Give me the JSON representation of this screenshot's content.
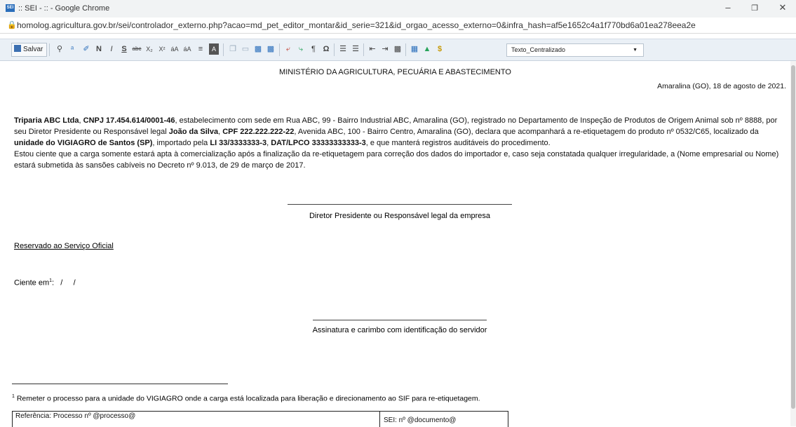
{
  "window": {
    "title": ":: SEI - :: - Google Chrome",
    "favicon_text": "SEI"
  },
  "urlbar": {
    "url": "homolog.agricultura.gov.br/sei/controlador_externo.php?acao=md_pet_editor_montar&id_serie=321&id_orgao_acesso_externo=0&infra_hash=af5e1652c4a1f770bd6a01ea278eea2e"
  },
  "toolbar": {
    "save_label": "Salvar",
    "style_select_value": "Texto_Centralizado"
  },
  "doc": {
    "heading": "MINISTÉRIO DA AGRICULTURA, PECUÁRIA E ABASTECIMENTO",
    "date_line": "Amaralina (GO), 18 de agosto de 2021.",
    "p1": {
      "company": "Triparia ABC Ltda",
      "cnpj": "CNPJ 17.454.614/0001-46",
      "text1": ", estabelecimento com sede em Rua ABC, 99 - Bairro Industrial ABC, Amaralina (GO), registrado no Departamento de Inspeção de Produtos de Origem Animal sob nº 8888, por seu Diretor Presidente ou Responsável legal ",
      "person": "João da Silva",
      "cpf": "CPF 222.222.222-22",
      "text2": ", Avenida ABC, 100 - Bairro Centro, Amaralina (GO), declara que acompanhará a re-etiquetagem do produto nº 0532/C65, localizado da ",
      "unit": "unidade do VIGIAGRO de Santos (SP)",
      "text3": ", importado pela ",
      "li": "LI 33/3333333-3",
      "dat": "DAT/LPCO 33333333333-3",
      "text4": ", e que manterá registros auditáveis do procedimento."
    },
    "p2": "Estou ciente que a carga somente estará apta à comercialização após a finalização da re-etiquetagem para correção dos dados do importador e, caso seja constatada qualquer irregularidade, a (Nome empresarial ou Nome) estará submetida às sansões cabíveis no Decreto nº 9.013, de 29 de março de 2017.",
    "signature1_label": "Diretor Presidente ou Responsável legal da empresa",
    "reserved_label": "Reservado ao Serviço Oficial",
    "ciente_label": "Ciente em",
    "ciente_sup": "1",
    "ciente_value": ":   /     /",
    "signature2_label": "Assinatura e carimbo com identificação do servidor",
    "footnote_mark": "1",
    "footnote": " Remeter o processo para a unidade do VIGIAGRO onde a carga está localizada para liberação e direcionamento ao SIF para re-etiquetagem.",
    "ref_label": "Referência: Processo nº @processo@",
    "sei_label": "SEI: nº @documento@"
  }
}
